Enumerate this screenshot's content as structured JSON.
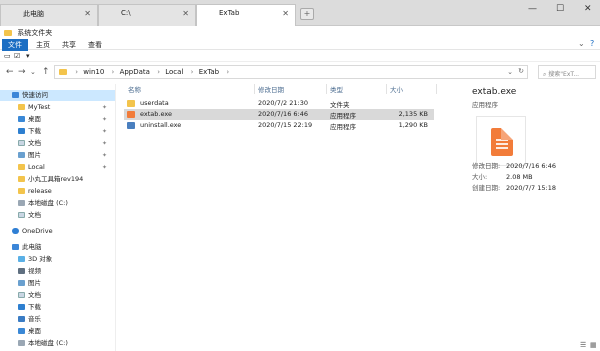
{
  "tabs": [
    {
      "label": "此电脑",
      "active": false
    },
    {
      "label": "C:\\",
      "active": false
    },
    {
      "label": "ExTab",
      "active": true
    }
  ],
  "window_controls": {
    "minimize": "—",
    "maximize": "☐",
    "close": "✕"
  },
  "title_bar": {
    "label": "系统文件夹"
  },
  "menu": {
    "file": "文件",
    "home": "主页",
    "share": "共享",
    "view": "查看"
  },
  "address": {
    "crumbs": [
      "win10",
      "AppData",
      "Local",
      "ExTab"
    ],
    "search_placeholder": "搜索\"ExT..."
  },
  "nav_pane": {
    "quick_access": "快速访问",
    "items": [
      {
        "label": "MyTest",
        "pinned": true
      },
      {
        "label": "桌面",
        "pinned": true
      },
      {
        "label": "下载",
        "pinned": true
      },
      {
        "label": "文档",
        "pinned": true
      },
      {
        "label": "图片",
        "pinned": true
      },
      {
        "label": "Local",
        "pinned": true
      },
      {
        "label": "小丸工具箱rev194",
        "pinned": false
      },
      {
        "label": "release",
        "pinned": false
      },
      {
        "label": "本地磁盘 (C:)",
        "pinned": false
      },
      {
        "label": "文档",
        "pinned": false
      }
    ],
    "onedrive": "OneDrive",
    "this_pc": "此电脑",
    "pc_items": [
      "3D 对象",
      "视频",
      "图片",
      "文档",
      "下载",
      "音乐",
      "桌面",
      "本地磁盘 (C:)"
    ]
  },
  "columns": {
    "name": "名称",
    "modified": "修改日期",
    "type": "类型",
    "size": "大小"
  },
  "files": [
    {
      "name": "userdata",
      "modified": "2020/7/2 21:30",
      "type": "文件夹",
      "size": "",
      "kind": "folder"
    },
    {
      "name": "extab.exe",
      "modified": "2020/7/16 6:46",
      "type": "应用程序",
      "size": "2,135 KB",
      "kind": "exe"
    },
    {
      "name": "uninstall.exe",
      "modified": "2020/7/15 22:19",
      "type": "应用程序",
      "size": "1,290 KB",
      "kind": "exe"
    }
  ],
  "details": {
    "title": "extab.exe",
    "type": "应用程序",
    "rows": [
      {
        "k": "修改日期:",
        "v": "2020/7/16 6:46"
      },
      {
        "k": "大小:",
        "v": "2.08 MB"
      },
      {
        "k": "创建日期:",
        "v": "2020/7/7 15:18"
      }
    ]
  },
  "colors": {
    "accent": "#1c6ec3",
    "folder": "#f3c44c",
    "selected_row": "#d9d9d9",
    "nav_selected": "#cce8ff",
    "app_icon": "#f27c3a"
  }
}
